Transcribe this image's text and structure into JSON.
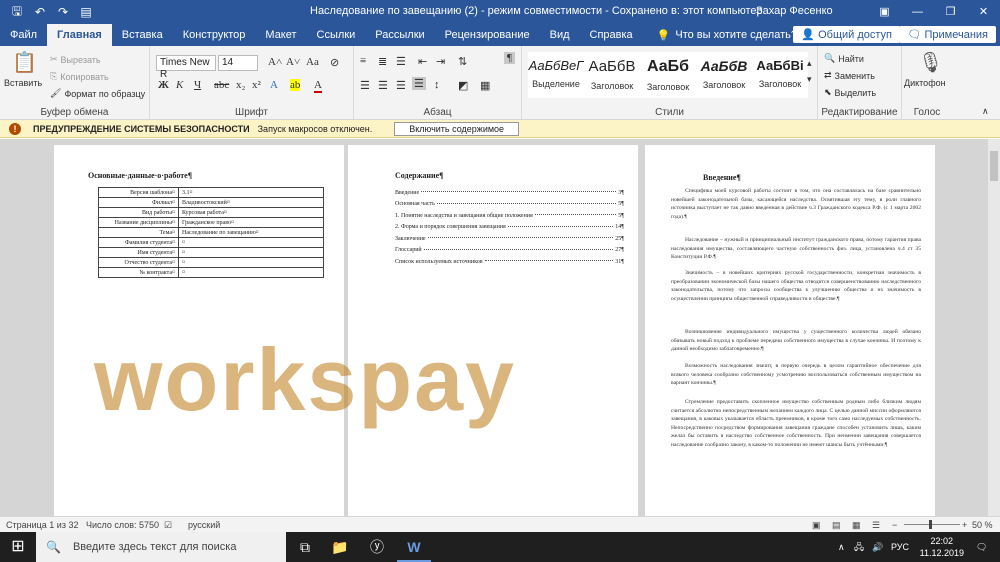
{
  "titlebar": {
    "doc_title": "Наследование по завещанию (2)  -  режим совместимости  -  Сохранено в: этот компьютер",
    "user": "Захар Фесенко",
    "save_icon": "save-icon",
    "undo_icon": "undo-icon",
    "redo_icon": "redo-icon",
    "mode_icon": "read-mode-icon"
  },
  "tabs": [
    {
      "label": "Файл"
    },
    {
      "label": "Главная"
    },
    {
      "label": "Вставка"
    },
    {
      "label": "Конструктор"
    },
    {
      "label": "Макет"
    },
    {
      "label": "Ссылки"
    },
    {
      "label": "Рассылки"
    },
    {
      "label": "Рецензирование"
    },
    {
      "label": "Вид"
    },
    {
      "label": "Справка"
    }
  ],
  "tell_me": "Что вы хотите сделать?",
  "share_label": "Общий доступ",
  "comments_label": "Примечания",
  "ribbon": {
    "clipboard": {
      "paste": "Вставить",
      "cut": "Вырезать",
      "copy": "Копировать",
      "format_painter": "Формат по образцу",
      "label": "Буфер обмена"
    },
    "font": {
      "name": "Times New R",
      "size": "14",
      "label": "Шрифт"
    },
    "paragraph": {
      "label": "Абзац"
    },
    "styles": {
      "items": [
        {
          "sample": "АаБбВеГ",
          "name": "Выделение"
        },
        {
          "sample": "АаБбВ",
          "name": "Заголовок"
        },
        {
          "sample": "АаБб",
          "name": "Заголовок"
        },
        {
          "sample": "АаБбВ",
          "name": "Заголовок"
        },
        {
          "sample": "АаБбВі",
          "name": "Заголовок"
        }
      ],
      "label": "Стили"
    },
    "editing": {
      "find": "Найти",
      "replace": "Заменить",
      "select": "Выделить",
      "label": "Редактирование"
    },
    "voice": {
      "dictate": "Диктофон",
      "label": "Голос"
    }
  },
  "warning": {
    "title": "ПРЕДУПРЕЖДЕНИЕ СИСТЕМЫ БЕЗОПАСНОСТИ",
    "message": "Запуск макросов отключен.",
    "button": "Включить содержимое"
  },
  "page1": {
    "heading": "Основные·данные·о·работе¶",
    "rows": [
      [
        "Версия шаблона¤",
        "3.1¤"
      ],
      [
        "Филиал¤",
        "Владивостокский¤"
      ],
      [
        "Вид работы¤",
        "Курсовая работа¤"
      ],
      [
        "Название дисциплины¤",
        "Гражданское право¤"
      ],
      [
        "Тема¤",
        "Наследование по завещанию¤"
      ],
      [
        "Фамилия студента¤",
        "¤"
      ],
      [
        "Имя студента¤",
        "¤"
      ],
      [
        "Отчество студента¤",
        "¤"
      ],
      [
        "№ контракта¤",
        "¤"
      ]
    ]
  },
  "page2": {
    "heading": "Содержание¶",
    "toc": [
      {
        "title": "Введение",
        "page": "3¶"
      },
      {
        "title": "Основная часть",
        "page": "5¶"
      },
      {
        "title": "1. Понятие наследства и завещания общие положения",
        "page": "5¶"
      },
      {
        "title": "2. Форма и порядок совершения завещания",
        "page": "14¶"
      },
      {
        "title": "Заключение",
        "page": "25¶"
      },
      {
        "title": "Глоссарий",
        "page": "27¶"
      },
      {
        "title": "Список используемых источников",
        "page": "31¶"
      }
    ]
  },
  "page3": {
    "heading": "Введение¶",
    "paragraphs": [
      "Специфика моей курсовой работы состоит в том, что она составлялась на базе сравнительно новейшей законодательной базы, касающейся наследства. Освятившая эту тему, в роли главного источника выступает не так давно введенная в действие ч.3 Гражданского кодекса Р.Ф. (с 1 марта 2002 года).¶",
      "Наследование – нужный и принципиальный институт гражданского права, потому гарантия права наследования имущества, составляющего частную собственность физ. лица, установлена ч.4 ст 35 Конституции Р.Ф.¶",
      "Значимость – в новейших критериях русской государственности, конкретная значимость в преобразовании экономической базы нашего общества отводится совершенствованию наследственного законодательства, потому что запросы сообщества к улучшению общества и их значимость в осуществлении принципа общественной справедливости в обществе.¶",
      "Возникновение индивидуального имущества у существенного количества людей обязано обязывать новый подход к проблеме передачи собственного имущества в случае кончины. И поэтому к данной необходимо заблаговременно.¶",
      "Возможность наследования значит, в первую очередь в целом гарантийное обеспечение для всякого человека сообразно собственному усмотрению воспользоваться собственным имуществом на вариант кончины.¶",
      "Стремление предоставить скопленное имущество собственным родным либо близким людям считается абсолютно непосредственным желанием каждого лица. С целью данной миссии оформляются завещания, в каковых указывается область преемников, в кроме того само наследуемых собственность. Непосредственно посредством формирования завещания граждане способен установить лишь, каким желал бы оставить в наследство собственное собственность. При неимении завещания совершается наследование сообразно закону, в каком-то положении не имеют шансы быть учтёнными.¶"
    ]
  },
  "watermark": "workspay",
  "status": {
    "page": "Страница 1 из 32",
    "words": "Число слов: 5750",
    "lang": "русский",
    "zoom": "50 %"
  },
  "taskbar": {
    "search_placeholder": "Введите здесь текст для поиска",
    "lang": "РУС",
    "time": "22:02",
    "date": "11.12.2019"
  }
}
